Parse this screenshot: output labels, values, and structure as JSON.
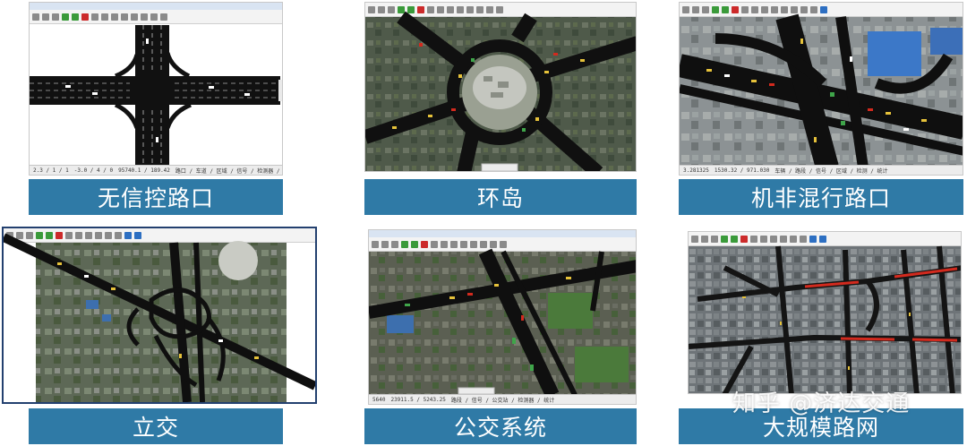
{
  "panels": [
    {
      "caption": "无信控路口",
      "status": [
        "2.3 / 1 / 1",
        "-3.0 / 4 / 0",
        "95740.1 / 189.42",
        "路口 / 车道 / 区域 / 信号 / 检测器 / 统计"
      ]
    },
    {
      "caption": "环岛",
      "status": []
    },
    {
      "caption": "机非混行路口",
      "status": [
        "3.281325",
        "1530.32 / 971.030",
        "车辆 / 路段 / 信号 / 区域 / 检测 / 统计"
      ]
    },
    {
      "caption": "立交",
      "status": []
    },
    {
      "caption": "公交系统",
      "status": [
        "5640",
        "23911.5 / 5243.25",
        "路段 / 信号 / 公交站 / 检测器 / 统计"
      ]
    },
    {
      "caption": "大规模路网",
      "status": []
    }
  ],
  "watermark": "知乎 @济达交通",
  "colors": {
    "caption_bg": "#2f7aa6",
    "caption_text": "#ffffff",
    "road": "#111111",
    "satellite_dark": "#3b4a3e",
    "satellite_green": "#4c6b3a",
    "traffic_red": "#d22a1e",
    "traffic_yellow": "#e6c23a"
  }
}
